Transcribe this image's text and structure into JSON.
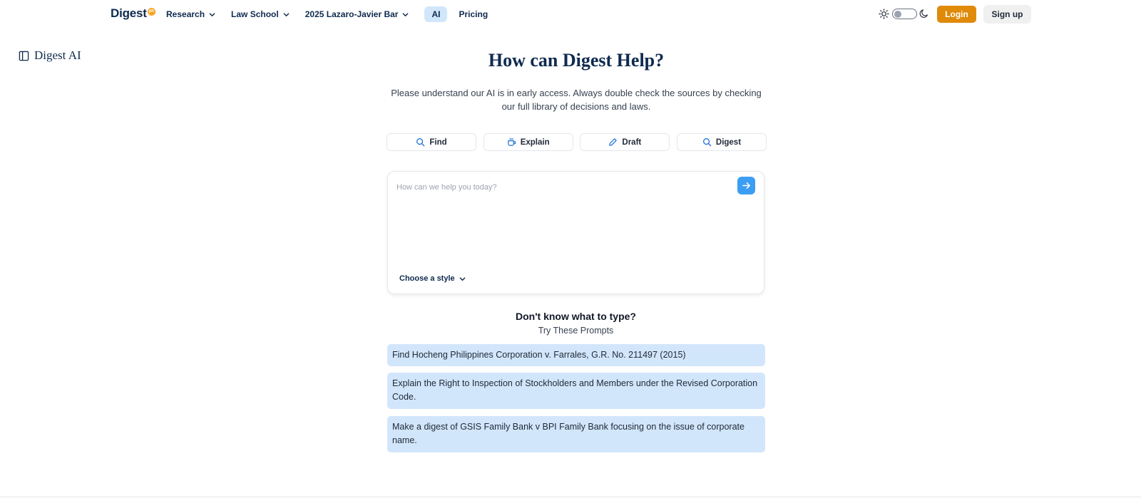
{
  "brand": {
    "name": "Digest",
    "badge": "ph"
  },
  "nav": {
    "items": [
      {
        "label": "Research",
        "dropdown": true
      },
      {
        "label": "Law School",
        "dropdown": true
      },
      {
        "label": "2025 Lazaro-Javier Bar",
        "dropdown": true
      },
      {
        "label": "AI",
        "active": true
      },
      {
        "label": "Pricing"
      }
    ],
    "login_label": "Login",
    "signup_label": "Sign up"
  },
  "sidebar": {
    "title": "Digest AI"
  },
  "main": {
    "title": "How can Digest Help?",
    "subtitle": "Please understand our AI is in early access. Always double check the sources by checking our full library of decisions and laws.",
    "modes": [
      {
        "label": "Find",
        "icon": "search-icon"
      },
      {
        "label": "Explain",
        "icon": "coffee-cup-icon"
      },
      {
        "label": "Draft",
        "icon": "pencil-icon"
      },
      {
        "label": "Digest",
        "icon": "search-icon"
      }
    ],
    "prompt": {
      "placeholder": "How can we help you today?",
      "value": "",
      "style_label": "Choose a style"
    },
    "help": {
      "title": "Don't know what to type?",
      "subtitle": "Try These Prompts",
      "suggestions": [
        "Find Hocheng Philippines Corporation v. Farrales, G.R. No. 211497 (2015)",
        "Explain the Right to Inspection of Stockholders and Members under the Revised Corporation Code.",
        "Make a digest of GSIS Family Bank v BPI Family Bank focusing on the issue of corporate name."
      ]
    }
  },
  "colors": {
    "navy": "#0f2a4f",
    "accent_orange": "#e08a0a",
    "accent_blue": "#3b9ef3",
    "suggestion_bg": "#d2e6fb"
  }
}
